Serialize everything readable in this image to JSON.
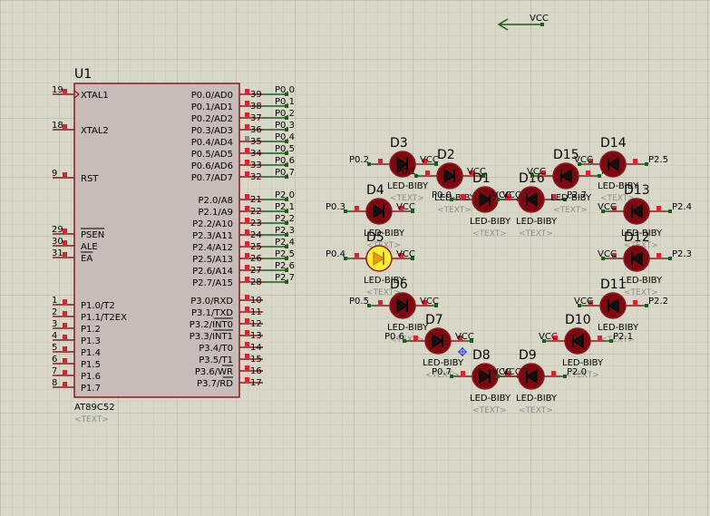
{
  "chip": {
    "ref": "U1",
    "part": "AT89C52",
    "text": "<TEXT>",
    "left_pins": [
      {
        "num": "19",
        "name": "XTAL1",
        "clock": true
      },
      {
        "num": "18",
        "name": "XTAL2"
      },
      {
        "num": "9",
        "name": "RST"
      },
      {
        "num": "29",
        "name": "PSEN",
        "overline": true
      },
      {
        "num": "30",
        "name": "ALE"
      },
      {
        "num": "31",
        "name": "EA",
        "overline": true
      },
      {
        "num": "1",
        "name": "P1.0/T2"
      },
      {
        "num": "2",
        "name": "P1.1/T2EX"
      },
      {
        "num": "3",
        "name": "P1.2"
      },
      {
        "num": "4",
        "name": "P1.3"
      },
      {
        "num": "5",
        "name": "P1.4"
      },
      {
        "num": "6",
        "name": "P1.5"
      },
      {
        "num": "7",
        "name": "P1.6"
      },
      {
        "num": "8",
        "name": "P1.7"
      }
    ],
    "right_pins": [
      {
        "num": "39",
        "name": "P0.0/AD0",
        "net": "P0.0"
      },
      {
        "num": "38",
        "name": "P0.1/AD1",
        "net": "P0.1"
      },
      {
        "num": "37",
        "name": "P0.2/AD2",
        "net": "P0.2"
      },
      {
        "num": "36",
        "name": "P0.3/AD3",
        "net": "P0.3"
      },
      {
        "num": "35",
        "name": "P0.4/AD4",
        "net": "P0.4",
        "state": "grey"
      },
      {
        "num": "34",
        "name": "P0.5/AD5",
        "net": "P0.5"
      },
      {
        "num": "33",
        "name": "P0.6/AD6",
        "net": "P0.6"
      },
      {
        "num": "32",
        "name": "P0.7/AD7",
        "net": "P0.7"
      },
      {
        "num": "21",
        "name": "P2.0/A8",
        "net": "P2.0"
      },
      {
        "num": "22",
        "name": "P2.1/A9",
        "net": "P2.1"
      },
      {
        "num": "23",
        "name": "P2.2/A10",
        "net": "P2.2"
      },
      {
        "num": "24",
        "name": "P2.3/A11",
        "net": "P2.3"
      },
      {
        "num": "25",
        "name": "P2.4/A12",
        "net": "P2.4"
      },
      {
        "num": "26",
        "name": "P2.5/A13",
        "net": "P2.5"
      },
      {
        "num": "27",
        "name": "P2.6/A14",
        "net": "P2.6"
      },
      {
        "num": "28",
        "name": "P2.7/A15",
        "net": "P2.7"
      },
      {
        "num": "10",
        "name": "P3.0/RXD"
      },
      {
        "num": "11",
        "name": "P3.1/TXD"
      },
      {
        "num": "12",
        "name": "P3.2/INT0",
        "overline": true
      },
      {
        "num": "13",
        "name": "P3.3/INT1",
        "overline": true
      },
      {
        "num": "14",
        "name": "P3.4/T0"
      },
      {
        "num": "15",
        "name": "P3.5/T1"
      },
      {
        "num": "16",
        "name": "P3.6/WR",
        "overline": true
      },
      {
        "num": "17",
        "name": "P3.7/RD",
        "overline": true
      }
    ]
  },
  "vcc_terminal": "VCC",
  "leds": [
    {
      "ref": "D3",
      "part": "LED-BIBY",
      "text": "<TEXT>",
      "net": "P0.2",
      "vcc": "VCC"
    },
    {
      "ref": "D2",
      "part": "LED-BIBY",
      "text": "<TEXT>",
      "net": "P0.1",
      "vcc": "VCC"
    },
    {
      "ref": "D1",
      "part": "LED-BIBY",
      "text": "<TEXT>",
      "net": "P0.0",
      "vcc": "VCC"
    },
    {
      "ref": "D16",
      "part": "LED-BIBY",
      "text": "<TEXT>",
      "net": "P2.7",
      "vcc": "VCC"
    },
    {
      "ref": "D15",
      "part": "LED-BIBY",
      "text": "<TEXT>",
      "net": "P2.6",
      "vcc": "VCC"
    },
    {
      "ref": "D14",
      "part": "LED-BIBY",
      "text": "<TEXT>",
      "net": "P2.5",
      "vcc": "VCC"
    },
    {
      "ref": "D4",
      "part": "LED-BIBY",
      "text": "<TEXT>",
      "net": "P0.3",
      "vcc": "VCC"
    },
    {
      "ref": "D13",
      "part": "LED-BIBY",
      "text": "<TEXT>",
      "net": "P2.4",
      "vcc": "VCC"
    },
    {
      "ref": "D5",
      "part": "LED-BIBY",
      "text": "<TEXT>",
      "net": "P0.4",
      "vcc": "VCC",
      "lit": true
    },
    {
      "ref": "D12",
      "part": "LED-BIBY",
      "text": "<TEXT>",
      "net": "P2.3",
      "vcc": "VCC"
    },
    {
      "ref": "D6",
      "part": "LED-BIBY",
      "text": "<TEXT>",
      "net": "P0.5",
      "vcc": "VCC"
    },
    {
      "ref": "D11",
      "part": "LED-BIBY",
      "text": "<TEXT>",
      "net": "P2.2",
      "vcc": "VCC"
    },
    {
      "ref": "D7",
      "part": "LED-BIBY",
      "text": "<TEXT>",
      "net": "P0.6",
      "vcc": "VCC"
    },
    {
      "ref": "D10",
      "part": "LED-BIBY",
      "text": "<TEXT>",
      "net": "P2.1",
      "vcc": "VCC"
    },
    {
      "ref": "D8",
      "part": "LED-BIBY",
      "text": "<TEXT>",
      "net": "P0.7",
      "vcc": "VCC"
    },
    {
      "ref": "D9",
      "part": "LED-BIBY",
      "text": "<TEXT>",
      "net": "P2.0",
      "vcc": "VCC"
    }
  ],
  "colors": {
    "background": "#d9d8c8",
    "grid_minor": "#c9c8b8",
    "grid_major": "#aeada0",
    "chip_fill": "#c7bcb7",
    "outline": "#8a1b24",
    "wire": "#1a5e1a",
    "pin_red": "#e0202a",
    "pin_grey": "#8a8a8a",
    "led_body": "#7a0a10",
    "led_lit": "#ffee33",
    "text": "#000000",
    "placeholder": "#8c8c8c"
  }
}
